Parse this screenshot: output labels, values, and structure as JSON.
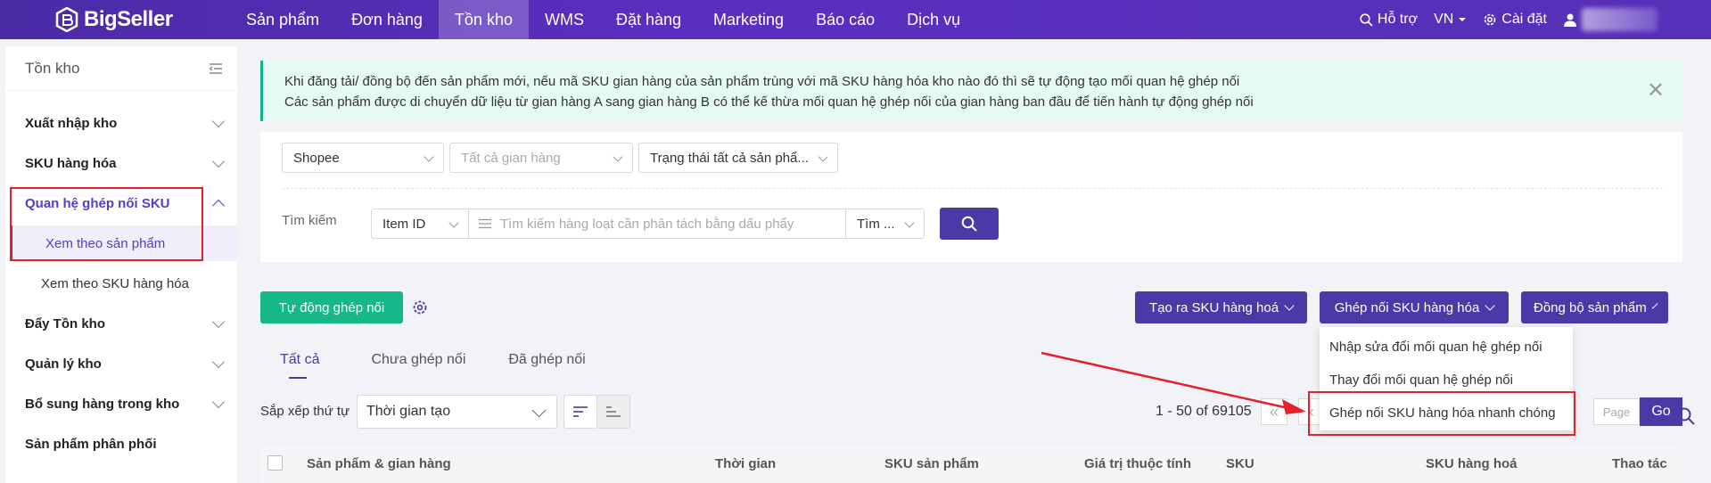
{
  "brand": {
    "name": "BigSeller"
  },
  "nav": {
    "items": [
      "Sản phẩm",
      "Đơn hàng",
      "Tồn kho",
      "WMS",
      "Đặt hàng",
      "Marketing",
      "Báo cáo",
      "Dịch vụ"
    ],
    "active_index": 2
  },
  "topbar_right": {
    "support": "Hỗ trợ",
    "lang": "VN",
    "settings": "Cài đặt"
  },
  "sidebar": {
    "title": "Tồn kho",
    "items": [
      {
        "label": "Xuất nhập kho"
      },
      {
        "label": "SKU hàng hóa"
      },
      {
        "label": "Quan hệ ghép nối SKU"
      },
      {
        "label": "Xem theo sản phẩm"
      },
      {
        "label": "Xem theo SKU hàng hóa"
      },
      {
        "label": "Đẩy Tồn kho"
      },
      {
        "label": "Quản lý kho"
      },
      {
        "label": "Bổ sung hàng trong kho"
      },
      {
        "label": "Sản phẩm phân phối"
      }
    ]
  },
  "notice": {
    "line1": "Khi đăng tải/ đồng bộ đến sản phẩm mới, nếu mã SKU gian hàng của sản phẩm trùng với mã SKU hàng hóa kho nào đó thì sẽ tự động tạo mối quan hệ ghép nối",
    "line2": "Các sản phẩm được di chuyển dữ liệu từ gian hàng A sang gian hàng B có thể kế thừa mối quan hệ ghép nối của gian hàng ban đầu để tiến hành tự động ghép nối"
  },
  "filters": {
    "platform": "Shopee",
    "store_placeholder": "Tất cả gian hàng",
    "status": "Trạng thái tất cả sản phẩ...",
    "search_label": "Tìm kiếm",
    "search_field": "Item ID",
    "search_placeholder": "Tìm kiếm hàng loạt cần phân tách bằng dấu phẩy",
    "search_mode": "Tìm ..."
  },
  "actions": {
    "auto_match": "Tự động ghép nối",
    "create_sku": "Tạo ra SKU hàng hoá",
    "match_sku": "Ghép nối SKU hàng hóa",
    "sync_products": "Đồng bộ sản phẩm"
  },
  "dropdown": {
    "items": [
      "Nhập sửa đổi mối quan hệ ghép nối",
      "Thay đổi mối quan hệ ghép nối",
      "Ghép nối SKU hàng hóa nhanh chóng"
    ]
  },
  "tabs": [
    "Tất cả",
    "Chưa ghép nối",
    "Đã ghép nối"
  ],
  "sort": {
    "label": "Sắp xếp thứ tự",
    "value": "Thời gian tạo"
  },
  "pager": {
    "info": "1 - 50 of 69105",
    "page_placeholder": "Page",
    "go": "Go",
    "first": "«",
    "prev": "‹"
  },
  "table": {
    "columns": [
      "Sản phẩm & gian hàng",
      "Thời gian",
      "SKU sản phẩm",
      "Giá trị thuộc tính",
      "SKU",
      "SKU hàng hoá",
      "Thao tác"
    ]
  },
  "colors": {
    "primary": "#4a3aa8",
    "accent_green": "#16b889",
    "highlight_red": "#e6202a"
  }
}
